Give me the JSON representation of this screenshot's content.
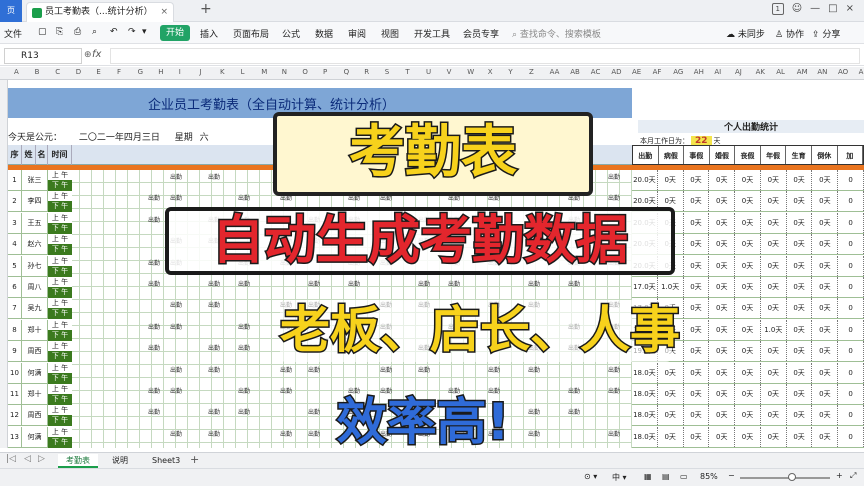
{
  "app": {
    "app_button": "页",
    "tab_title": "员工考勤表（...统计分析）",
    "tab_close": "×",
    "new_tab": "+",
    "page_badge": "1"
  },
  "toolbar": {
    "file": "文件",
    "start": "开始",
    "insert": "插入",
    "page_layout": "页面布局",
    "formula": "公式",
    "data": "数据",
    "review": "审阅",
    "view": "视图",
    "dev_tools": "开发工具",
    "member": "会员专享",
    "search": "查找命令、搜索模板",
    "unsynced": "未同步",
    "collab": "协作",
    "share": "分享"
  },
  "formula_bar": {
    "cell_ref": "R13",
    "fx": "fx"
  },
  "columns": [
    "A",
    "B",
    "C",
    "D",
    "E",
    "F",
    "G",
    "H",
    "I",
    "J",
    "K",
    "L",
    "M",
    "N",
    "O",
    "P",
    "Q",
    "R",
    "S",
    "T",
    "U",
    "V",
    "W",
    "X",
    "Y",
    "Z",
    "AA",
    "AB",
    "AC",
    "AD",
    "AE",
    "AF",
    "AG",
    "AH",
    "AI",
    "AJ",
    "AK",
    "AL",
    "AM",
    "AN",
    "AO",
    "AP"
  ],
  "sheet": {
    "banner_title": "企业员工考勤表（全自动计算、统计分析）",
    "today_label": "今天是公元：",
    "today_date": "二〇二一年四月三日",
    "weekday_label": "星期",
    "weekday": "六",
    "personal_stats_title": "个人出勤统计",
    "work_days_label": "本月工作日为：",
    "work_days": "22",
    "work_days_unit": "天",
    "header_cells": [
      "序号",
      "姓",
      "名",
      "时间"
    ],
    "stats_headers": [
      "出勤",
      "病假",
      "事假",
      "婚假",
      "丧假",
      "年假",
      "生育",
      "倒休",
      "加"
    ],
    "rows": [
      {
        "seq": "1",
        "name": "张三",
        "am": "上 午",
        "pm": "下 午",
        "stats": [
          "20.0天",
          "0天",
          "0天",
          "0天",
          "0天",
          "0天",
          "0天",
          "0天",
          "0"
        ]
      },
      {
        "seq": "2",
        "name": "李四",
        "am": "上 午",
        "pm": "下 午",
        "stats": [
          "20.0天",
          "0天",
          "0天",
          "0天",
          "0天",
          "0天",
          "0天",
          "0天",
          "0"
        ]
      },
      {
        "seq": "3",
        "name": "王五",
        "am": "上 午",
        "pm": "下 午",
        "stats": [
          "20.0天",
          "0天",
          "0天",
          "0天",
          "0天",
          "0天",
          "0天",
          "0天",
          "0"
        ]
      },
      {
        "seq": "4",
        "name": "赵六",
        "am": "上 午",
        "pm": "下 午",
        "stats": [
          "20.0天",
          "0天",
          "0天",
          "0天",
          "0天",
          "0天",
          "0天",
          "0天",
          "0"
        ]
      },
      {
        "seq": "5",
        "name": "孙七",
        "am": "上 午",
        "pm": "下 午",
        "stats": [
          "20.0天",
          "0天",
          "0天",
          "0天",
          "0天",
          "0天",
          "0天",
          "0天",
          "0"
        ]
      },
      {
        "seq": "6",
        "name": "周八",
        "am": "上 午",
        "pm": "下 午",
        "stats": [
          "17.0天",
          "1.0天",
          "0天",
          "0天",
          "0天",
          "0天",
          "0天",
          "0天",
          "0"
        ]
      },
      {
        "seq": "7",
        "name": "吴九",
        "am": "上 午",
        "pm": "下 午",
        "stats": [
          "17.0天",
          "0天",
          "0天",
          "0天",
          "0天",
          "0天",
          "0天",
          "0天",
          "0"
        ]
      },
      {
        "seq": "8",
        "name": "郑十",
        "am": "上 午",
        "pm": "下 午",
        "stats": [
          "17.0天",
          "0天",
          "0天",
          "0天",
          "0天",
          "1.0天",
          "0天",
          "0天",
          "0"
        ]
      },
      {
        "seq": "9",
        "name": "周西",
        "am": "上 午",
        "pm": "下 午",
        "stats": [
          "19.0天",
          "0天",
          "0天",
          "0天",
          "0天",
          "0天",
          "0天",
          "0天",
          "0"
        ]
      },
      {
        "seq": "10",
        "name": "何满",
        "am": "上 午",
        "pm": "下 午",
        "stats": [
          "18.0天",
          "0天",
          "0天",
          "0天",
          "0天",
          "0天",
          "0天",
          "0天",
          "0"
        ]
      },
      {
        "seq": "11",
        "name": "郑十",
        "am": "上 午",
        "pm": "下 午",
        "stats": [
          "18.0天",
          "0天",
          "0天",
          "0天",
          "0天",
          "0天",
          "0天",
          "0天",
          "0"
        ]
      },
      {
        "seq": "12",
        "name": "周西",
        "am": "上 午",
        "pm": "下 午",
        "stats": [
          "18.0天",
          "0天",
          "0天",
          "0天",
          "0天",
          "0天",
          "0天",
          "0天",
          "0"
        ]
      },
      {
        "seq": "13",
        "name": "何满",
        "am": "上 午",
        "pm": "下 午",
        "stats": [
          "18.0天",
          "0天",
          "0天",
          "0天",
          "0天",
          "0天",
          "0天",
          "0天",
          "0"
        ]
      }
    ],
    "cell_text": "出勤"
  },
  "overlay": {
    "line1": "考勤表",
    "line2": "自动生成考勤数据",
    "line3": "老板、店长、人事",
    "line4": "效率高!"
  },
  "sheet_tabs": [
    "考勤表",
    "说明",
    "Sheet3"
  ],
  "status": {
    "zoom": "85%"
  }
}
